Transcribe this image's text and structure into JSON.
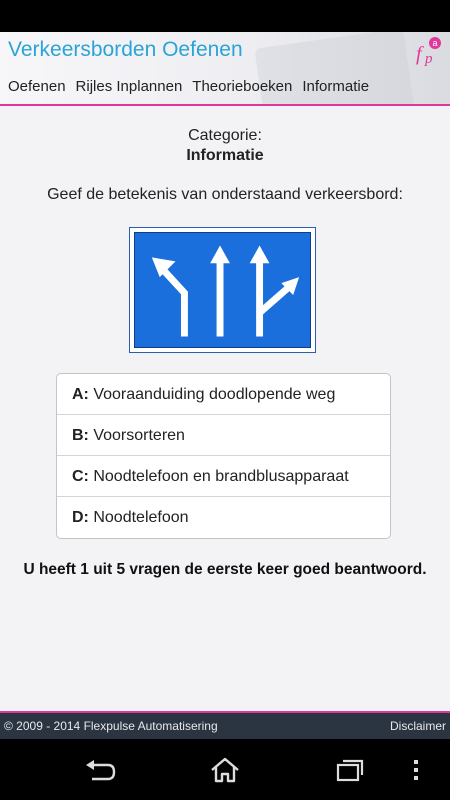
{
  "header": {
    "title": "Verkeersborden Oefenen",
    "logo_text": "fpa",
    "nav": [
      "Oefenen",
      "Rijles Inplannen",
      "Theorieboeken",
      "Informatie"
    ]
  },
  "quiz": {
    "category_label": "Categorie:",
    "category_value": "Informatie",
    "question": "Geef de betekenis van onderstaand verkeersbord:",
    "sign_icon": "lane-selection-sign-icon",
    "answers": [
      {
        "letter": "A:",
        "text": "Vooraanduiding doodlopende weg"
      },
      {
        "letter": "B:",
        "text": "Voorsorteren"
      },
      {
        "letter": "C:",
        "text": "Noodtelefoon en brandblusapparaat"
      },
      {
        "letter": "D:",
        "text": "Noodtelefoon"
      }
    ],
    "result": "U heeft 1 uit 5 vragen de eerste keer goed beantwoord."
  },
  "footer": {
    "copyright": "© 2009 - 2014 Flexpulse Automatisering",
    "disclaimer": "Disclaimer"
  },
  "system_nav": [
    "back-icon",
    "home-icon",
    "recent-apps-icon",
    "overflow-menu-icon"
  ],
  "colors": {
    "title": "#2aa4d6",
    "accent": "#e0389a",
    "sign_blue": "#1a6fdc",
    "footer_bg": "#2b3542"
  }
}
